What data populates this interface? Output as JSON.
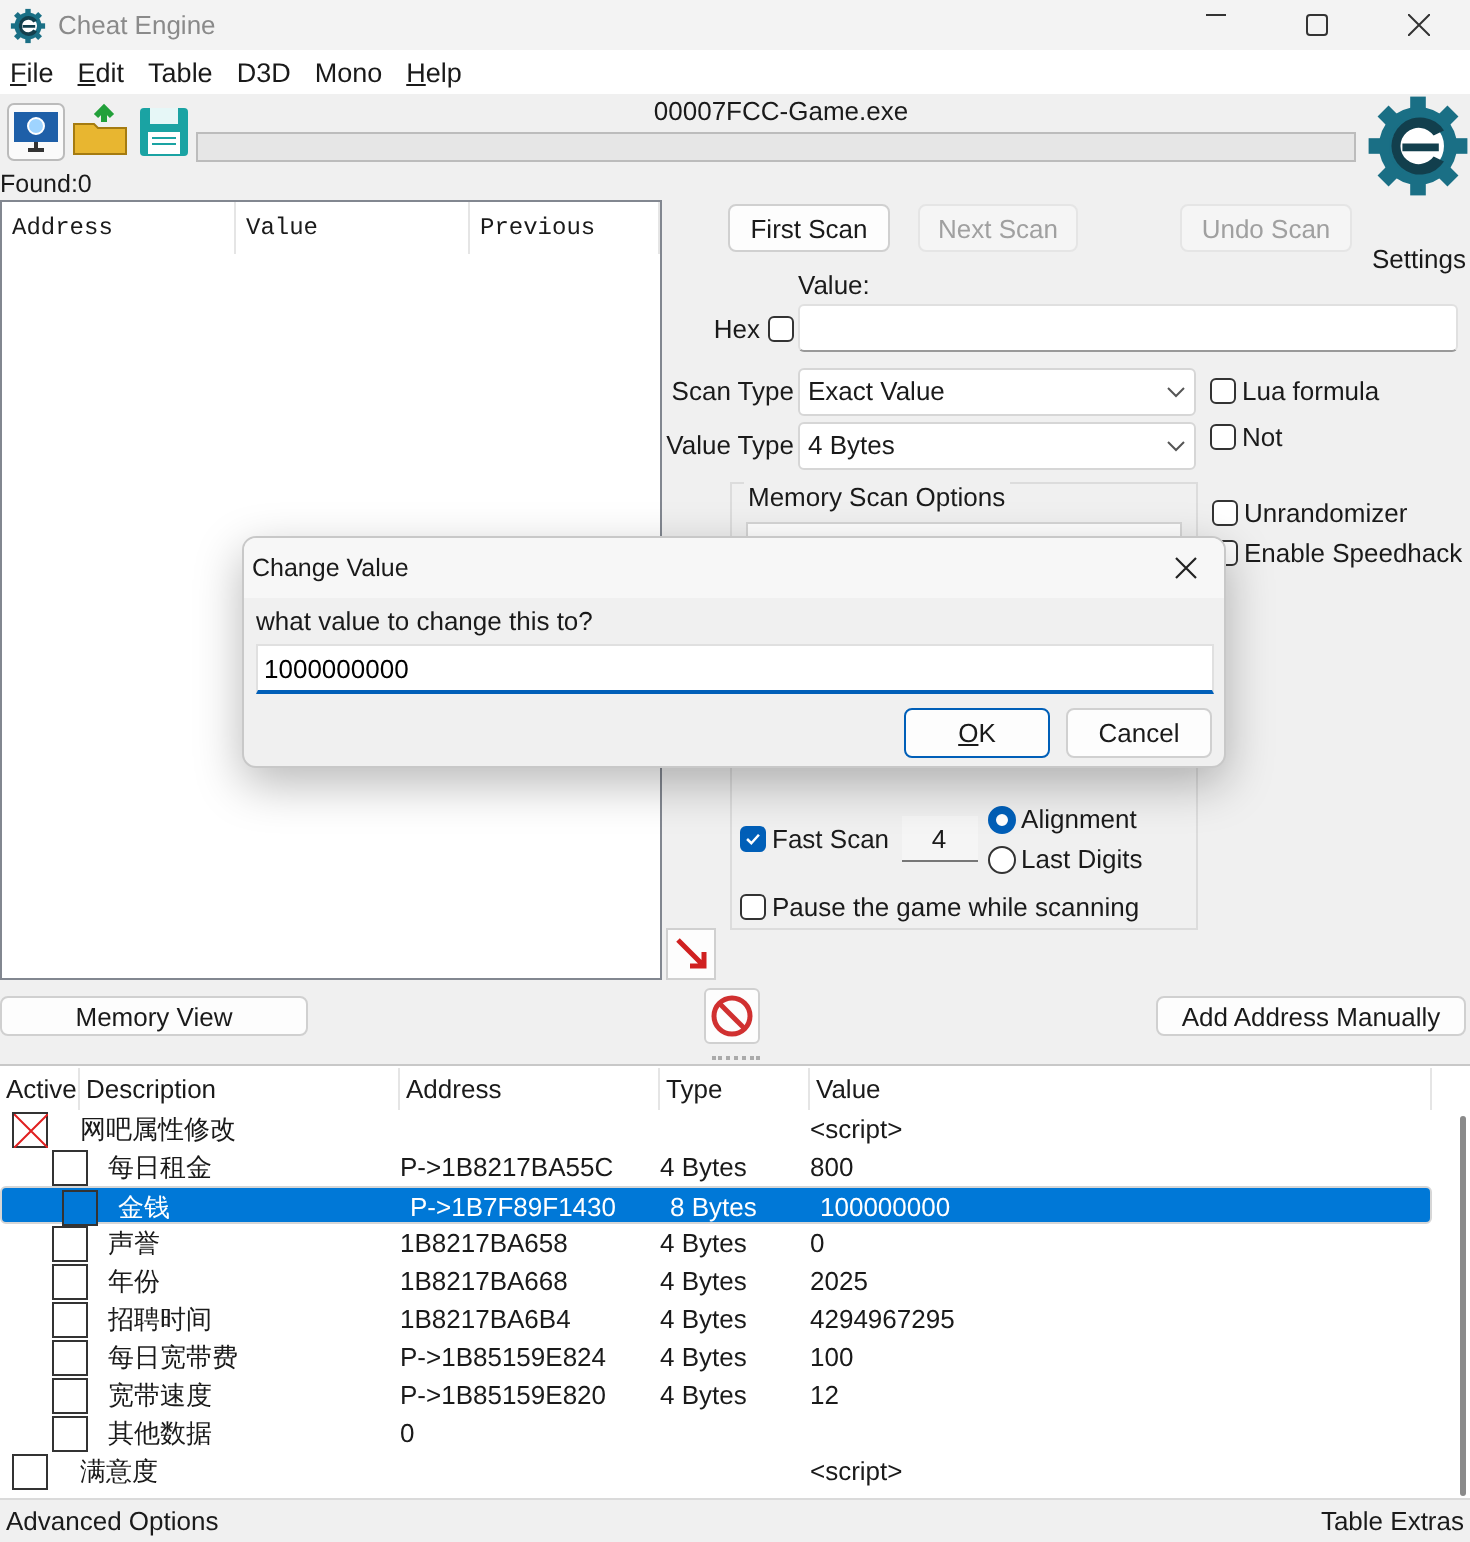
{
  "window": {
    "title": "Cheat Engine"
  },
  "menu": [
    {
      "label": "File",
      "underlined": true
    },
    {
      "label": "Edit",
      "underlined": true
    },
    {
      "label": "Table",
      "underlined": false
    },
    {
      "label": "D3D",
      "underlined": false
    },
    {
      "label": "Mono",
      "underlined": false
    },
    {
      "label": "Help",
      "underlined": true
    }
  ],
  "process": "00007FCC-Game.exe",
  "progress": {
    "level": 0
  },
  "settings_label": "Settings",
  "found": "Found:0",
  "results_table": {
    "columns": [
      "Address",
      "Value",
      "Previous"
    ]
  },
  "scan_buttons": [
    {
      "label": "First Scan",
      "disabled": false
    },
    {
      "label": "Next Scan",
      "disabled": true
    },
    {
      "label": "Undo Scan",
      "disabled": true
    }
  ],
  "value": {
    "label": "Value:",
    "hex_label": "Hex",
    "hex_checked": false
  },
  "scan_type": {
    "label": "Scan Type",
    "value": "Exact Value"
  },
  "value_type": {
    "label": "Value Type",
    "value": "4 Bytes"
  },
  "options": [
    {
      "label": "Lua formula",
      "checked": false
    },
    {
      "label": "Not",
      "checked": false
    },
    {
      "label": "Unrandomizer",
      "checked": false
    },
    {
      "label": "Enable Speedhack",
      "checked": false
    }
  ],
  "memory_scan_options": {
    "title": "Memory Scan Options",
    "fast_scan": {
      "label": "Fast Scan",
      "checked": true,
      "value": "4"
    },
    "alignment": [
      {
        "label": "Alignment",
        "selected": true
      },
      {
        "label": "Last Digits",
        "selected": false
      }
    ],
    "pause": {
      "label": "Pause the game while scanning",
      "checked": false
    }
  },
  "buttons": {
    "memory_view": "Memory View",
    "add_address": "Add Address Manually"
  },
  "address_list": {
    "columns": [
      "Active",
      "Description",
      "Address",
      "Type",
      "Value"
    ],
    "rows": [
      {
        "active": true,
        "selected": false,
        "description": "网吧属性修改",
        "value": "<script>",
        "children": [
          {
            "active": false,
            "selected": false,
            "description": "每日租金",
            "address": "P->1B8217BA55C",
            "type": "4 Bytes",
            "value": "800"
          },
          {
            "active": false,
            "selected": true,
            "description": "金钱",
            "address": "P->1B7F89F1430",
            "type": "8 Bytes",
            "value": "100000000"
          },
          {
            "active": false,
            "selected": false,
            "description": "声誉",
            "address": "1B8217BA658",
            "type": "4 Bytes",
            "value": "0"
          },
          {
            "active": false,
            "selected": false,
            "description": "年份",
            "address": "1B8217BA668",
            "type": "4 Bytes",
            "value": "2025"
          },
          {
            "active": false,
            "selected": false,
            "description": "招聘时间",
            "address": "1B8217BA6B4",
            "type": "4 Bytes",
            "value": "4294967295"
          },
          {
            "active": false,
            "selected": false,
            "description": "每日宽带费",
            "address": "P->1B85159E824",
            "type": "4 Bytes",
            "value": "100"
          },
          {
            "active": false,
            "selected": false,
            "description": "宽带速度",
            "address": "P->1B85159E820",
            "type": "4 Bytes",
            "value": "12"
          },
          {
            "active": false,
            "selected": false,
            "description": "其他数据",
            "address": "0"
          }
        ]
      },
      {
        "active": false,
        "selected": false,
        "description": "满意度",
        "value": "<script>"
      }
    ]
  },
  "status_bar": {
    "left": "Advanced Options",
    "right": "Table Extras"
  },
  "dialog": {
    "title": "Change Value",
    "prompt": "what value to change this to?",
    "value": "1000000000",
    "buttons": [
      {
        "label": "OK",
        "default": true,
        "underlined": true
      },
      {
        "label": "Cancel",
        "default": false,
        "underlined": false
      }
    ]
  }
}
